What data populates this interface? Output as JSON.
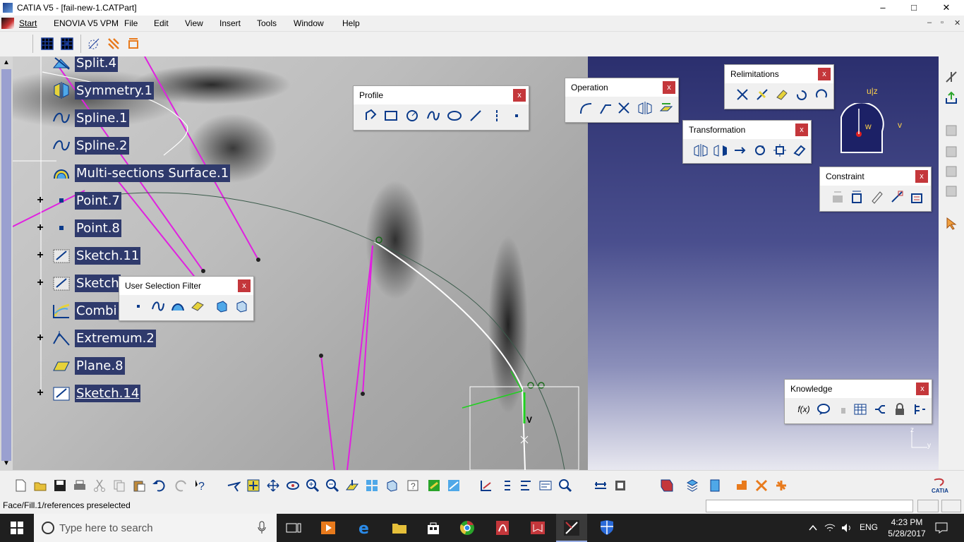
{
  "window": {
    "title": "CATIA V5 - [fail-new-1.CATPart]",
    "minimize": "–",
    "maximize": "□",
    "close": "✕"
  },
  "menu": {
    "items": [
      "Start",
      "ENOVIA V5 VPM",
      "File",
      "Edit",
      "View",
      "Insert",
      "Tools",
      "Window",
      "Help"
    ],
    "doc_min": "–",
    "doc_restore": "▫",
    "doc_close": "✕"
  },
  "tree": {
    "items": [
      {
        "label": "Split.4",
        "expand": ""
      },
      {
        "label": "Symmetry.1",
        "expand": ""
      },
      {
        "label": "Spline.1",
        "expand": ""
      },
      {
        "label": "Spline.2",
        "expand": ""
      },
      {
        "label": "Multi-sections Surface.1",
        "expand": ""
      },
      {
        "label": "Point.7",
        "expand": "+"
      },
      {
        "label": "Point.8",
        "expand": "+"
      },
      {
        "label": "Sketch.11",
        "expand": "+"
      },
      {
        "label": "Sketch",
        "expand": "+"
      },
      {
        "label": "Combi",
        "expand": ""
      },
      {
        "label": "Extremum.2",
        "expand": "+"
      },
      {
        "label": "Plane.8",
        "expand": ""
      },
      {
        "label": "Sketch.14",
        "expand": "+"
      }
    ]
  },
  "toolbars": {
    "profile": {
      "title": "Profile",
      "close": "x"
    },
    "operation": {
      "title": "Operation",
      "close": "x"
    },
    "relimitations": {
      "title": "Relimitations",
      "close": "x"
    },
    "transformation": {
      "title": "Transformation",
      "close": "x"
    },
    "constraint": {
      "title": "Constraint",
      "close": "x"
    },
    "user_selection_filter": {
      "title": "User Selection Filter",
      "close": "x"
    },
    "knowledge": {
      "title": "Knowledge",
      "close": "x",
      "formula": "f(x)"
    }
  },
  "compass": {
    "u_z": "u|z",
    "w": "w",
    "v": "v"
  },
  "viewport_labels": {
    "v_marker": "V",
    "axis_z": "z",
    "axis_y": "y"
  },
  "status": {
    "message": "Face/Fill.1/references preselected"
  },
  "taskbar": {
    "search_placeholder": "Type here to search",
    "language": "ENG",
    "time": "4:23 PM",
    "date": "5/28/2017"
  },
  "colors": {
    "tree_highlight": "#2f3a6c",
    "close_button": "#c4373b",
    "magenta_lines": "#e020e0",
    "viewport_blue": "#2b2f6e"
  }
}
